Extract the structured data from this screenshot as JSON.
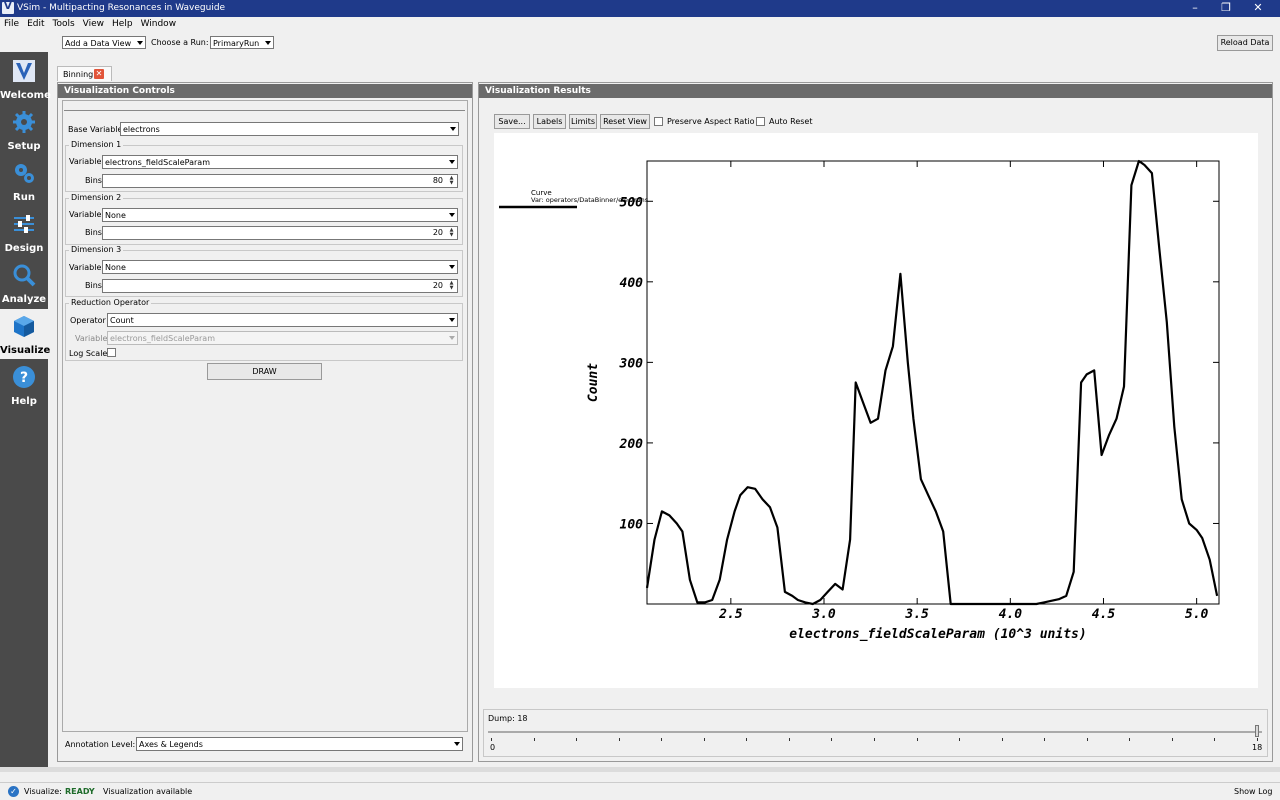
{
  "window": {
    "title": "VSim - Multipacting Resonances in Waveguide",
    "minimize": "–",
    "maximize": "❐",
    "close": "✕"
  },
  "menu": [
    "File",
    "Edit",
    "Tools",
    "View",
    "Help",
    "Window"
  ],
  "sidebar": [
    {
      "label": "Welcome",
      "icon": "vsim-logo-icon"
    },
    {
      "label": "Setup",
      "icon": "gear-icon"
    },
    {
      "label": "Run",
      "icon": "gears-icon"
    },
    {
      "label": "Design",
      "icon": "sliders-icon"
    },
    {
      "label": "Analyze",
      "icon": "magnifier-icon"
    },
    {
      "label": "Visualize",
      "icon": "cube-icon"
    },
    {
      "label": "Help",
      "icon": "help-icon"
    }
  ],
  "toolbar": {
    "add_data_view": "Add a Data View",
    "choose_run_label": "Choose a Run:",
    "run_value": "PrimaryRun",
    "reload": "Reload Data"
  },
  "tab": {
    "label": "Binning"
  },
  "controls": {
    "header": "Visualization Controls",
    "base_variable_label": "Base Variable:",
    "base_variable": "electrons",
    "dim1": {
      "title": "Dimension 1",
      "variable_label": "Variable",
      "variable": "electrons_fieldScaleParam",
      "bins_label": "Bins",
      "bins": "80"
    },
    "dim2": {
      "title": "Dimension 2",
      "variable_label": "Variable",
      "variable": "None",
      "bins_label": "Bins",
      "bins": "20"
    },
    "dim3": {
      "title": "Dimension 3",
      "variable_label": "Variable",
      "variable": "None",
      "bins_label": "Bins",
      "bins": "20"
    },
    "reduction": {
      "title": "Reduction Operator",
      "operator_label": "Operator",
      "operator": "Count",
      "variable_label": "Variable",
      "variable": "electrons_fieldScaleParam",
      "log_scale_label": "Log Scale"
    },
    "draw": "DRAW",
    "annotation_label": "Annotation Level:",
    "annotation_value": "Axes & Legends"
  },
  "results": {
    "header": "Visualization Results",
    "buttons": [
      "Save...",
      "Labels",
      "Limits",
      "Reset View"
    ],
    "preserve_aspect": "Preserve Aspect Ratio",
    "auto_reset": "Auto Reset",
    "dump_label": "Dump: 18",
    "dump_min": "0",
    "dump_max": "18",
    "dump_value": 18
  },
  "status": {
    "label": "Visualize:",
    "state": "READY",
    "message": "Visualization available",
    "show_log": "Show Log"
  },
  "chart_data": {
    "type": "line",
    "xlabel": "electrons_fieldScaleParam (10^3 units)",
    "ylabel": "Count",
    "legend": [
      "Curve",
      "Var: operators/DataBinner/electrons"
    ],
    "xlim": [
      2.05,
      5.12
    ],
    "ylim": [
      0,
      550
    ],
    "xticks": [
      2.5,
      3.0,
      3.5,
      4.0,
      4.5,
      5.0
    ],
    "xtick_labels": [
      "2.5",
      "3.0",
      "3.5",
      "4.0",
      "4.5",
      "5.0"
    ],
    "yticks": [
      100,
      200,
      300,
      400,
      500
    ],
    "ytick_labels": [
      "100",
      "200",
      "300",
      "400",
      "500"
    ],
    "series": [
      {
        "x": [
          2.05,
          2.09,
          2.13,
          2.17,
          2.21,
          2.24,
          2.28,
          2.32,
          2.36,
          2.4,
          2.44,
          2.48,
          2.52,
          2.55,
          2.59,
          2.63,
          2.67,
          2.71,
          2.75,
          2.79,
          2.83,
          2.86,
          2.9,
          2.94,
          2.98,
          3.02,
          3.06,
          3.1,
          3.14,
          3.17,
          3.21,
          3.25,
          3.29,
          3.33,
          3.37,
          3.41,
          3.45,
          3.48,
          3.52,
          3.56,
          3.6,
          3.64,
          3.68,
          3.72,
          3.76,
          3.79,
          3.83,
          3.87,
          3.91,
          3.95,
          3.99,
          4.03,
          4.07,
          4.1,
          4.14,
          4.18,
          4.22,
          4.26,
          4.3,
          4.34,
          4.38,
          4.41,
          4.45,
          4.49,
          4.53,
          4.57,
          4.61,
          4.65,
          4.69,
          4.72,
          4.76,
          4.8,
          4.84,
          4.88,
          4.92,
          4.96,
          5.0,
          5.03,
          5.07,
          5.11
        ],
        "y": [
          20,
          80,
          115,
          110,
          100,
          90,
          30,
          2,
          2,
          5,
          30,
          80,
          115,
          135,
          145,
          143,
          130,
          120,
          95,
          15,
          10,
          5,
          2,
          0,
          5,
          15,
          25,
          18,
          80,
          275,
          250,
          225,
          230,
          290,
          320,
          410,
          300,
          230,
          155,
          135,
          115,
          90,
          0,
          0,
          0,
          0,
          0,
          0,
          0,
          0,
          0,
          0,
          0,
          0,
          0,
          2,
          4,
          6,
          10,
          40,
          275,
          285,
          290,
          185,
          210,
          230,
          270,
          520,
          550,
          545,
          535,
          440,
          350,
          220,
          130,
          100,
          92,
          82,
          55,
          10
        ]
      }
    ]
  }
}
